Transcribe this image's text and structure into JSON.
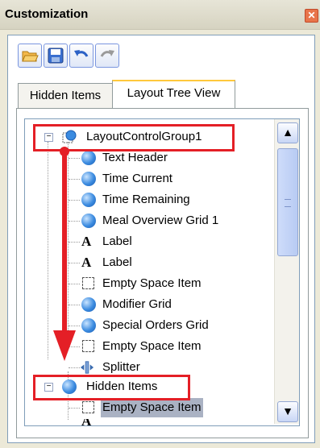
{
  "window": {
    "title": "Customization",
    "close_glyph": "✕"
  },
  "toolbar": {
    "open_icon": "folder-open-icon",
    "save_icon": "save-icon",
    "undo_icon": "undo-icon",
    "redo_icon": "redo-icon"
  },
  "tabs": [
    {
      "label": "Hidden Items",
      "active": false
    },
    {
      "label": "Layout Tree View",
      "active": true
    }
  ],
  "tree": {
    "root": {
      "label": "LayoutControlGroup1",
      "expander": "−"
    },
    "children": [
      {
        "label": "Text Header",
        "icon": "ball"
      },
      {
        "label": "Time Current",
        "icon": "ball"
      },
      {
        "label": "Time Remaining",
        "icon": "ball"
      },
      {
        "label": "Meal Overview Grid 1",
        "icon": "ball"
      },
      {
        "label": "Label",
        "icon": "letter"
      },
      {
        "label": "Label",
        "icon": "letter"
      },
      {
        "label": "Empty Space Item",
        "icon": "empty"
      },
      {
        "label": "Modifier Grid",
        "icon": "ball"
      },
      {
        "label": "Special Orders Grid",
        "icon": "ball"
      },
      {
        "label": "Empty Space Item",
        "icon": "empty"
      },
      {
        "label": "Splitter",
        "icon": "splitter"
      }
    ],
    "hidden": {
      "label": "Hidden Items",
      "expander": "−"
    },
    "hidden_children": [
      {
        "label": "Empty Space Item",
        "icon": "empty",
        "selected": true
      }
    ]
  },
  "scrollbar": {
    "up": "▲",
    "down": "▼"
  },
  "colors": {
    "highlight_red": "#e41f26",
    "selection": "#aab2c3"
  }
}
